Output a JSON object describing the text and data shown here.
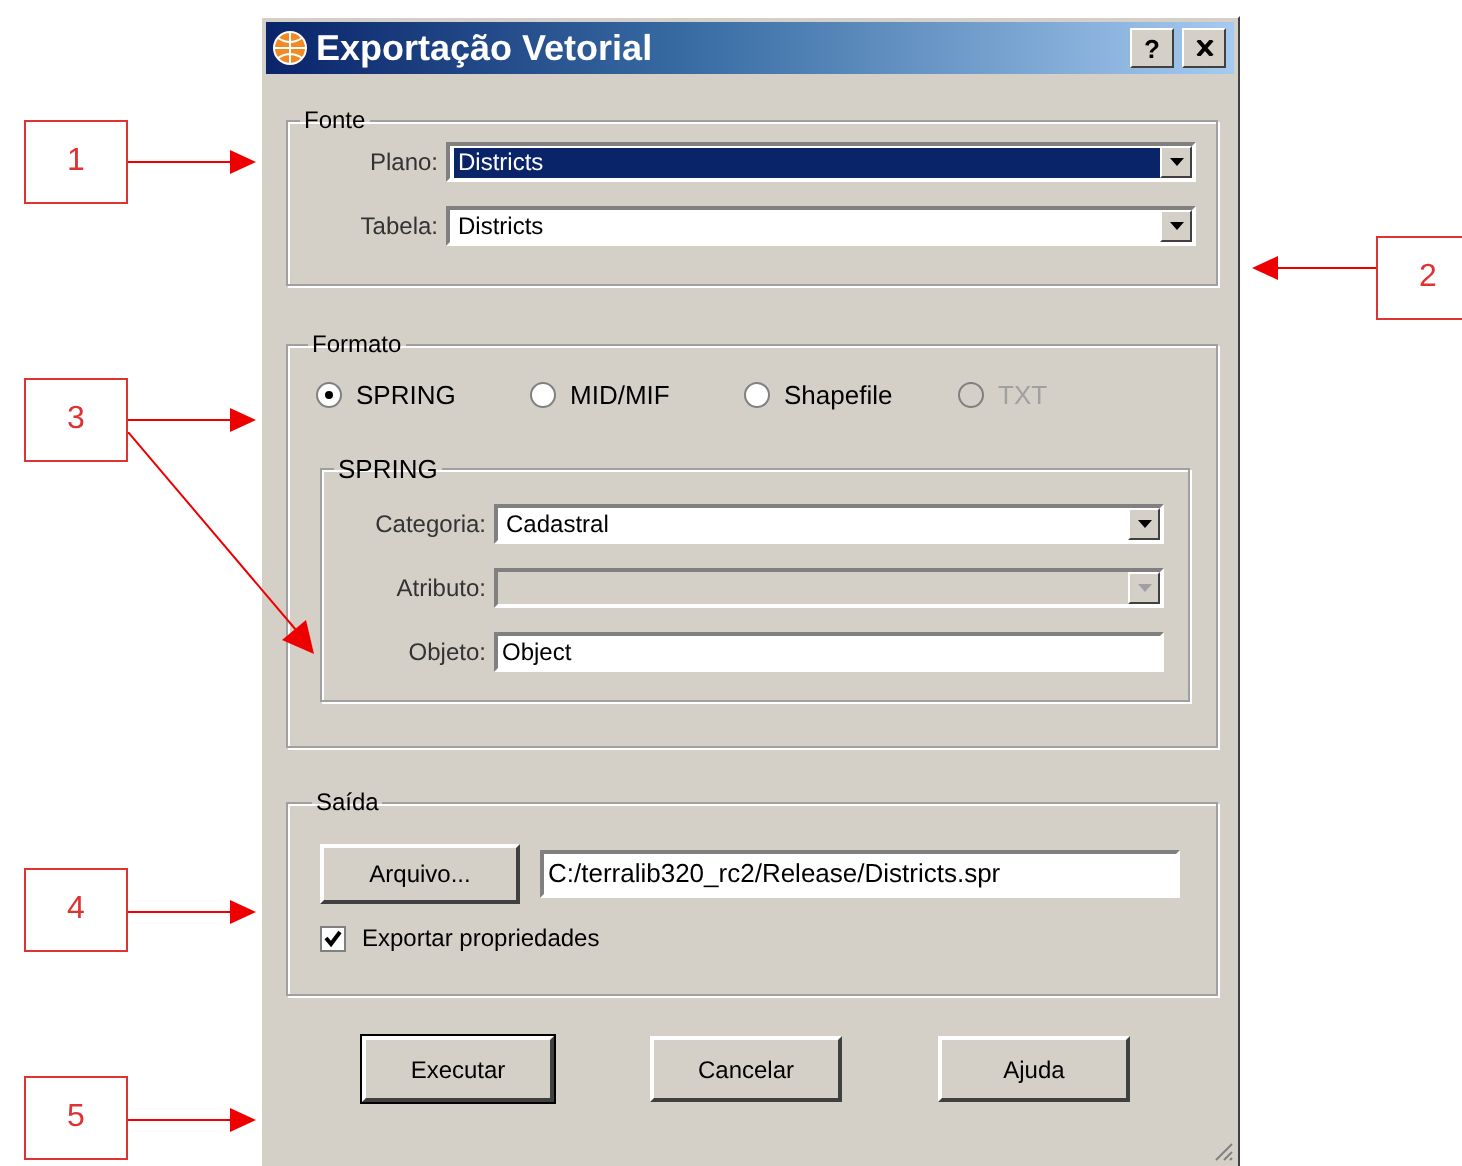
{
  "window": {
    "title": "Exportação Vetorial",
    "help": "?"
  },
  "fonte": {
    "title": "Fonte",
    "fields": [
      {
        "label": "Plano:",
        "value": "Districts",
        "selected": true,
        "disabled": false
      },
      {
        "label": "Tabela:",
        "value": "Districts",
        "selected": false,
        "disabled": false
      }
    ]
  },
  "formato": {
    "title": "Formato",
    "options": [
      {
        "label": "SPRING",
        "selected": true,
        "disabled": false
      },
      {
        "label": "MID/MIF",
        "selected": false,
        "disabled": false
      },
      {
        "label": "Shapefile",
        "selected": false,
        "disabled": false
      },
      {
        "label": "TXT",
        "selected": false,
        "disabled": true
      }
    ],
    "spring": {
      "title": "SPRING",
      "fields": [
        {
          "kind": "dropdown",
          "label": "Categoria:",
          "value": "Cadastral",
          "disabled": false
        },
        {
          "kind": "dropdown",
          "label": "Atributo:",
          "disabled": true
        },
        {
          "kind": "text",
          "label": "Objeto:",
          "value": "Object",
          "disabled": false
        }
      ]
    }
  },
  "saida": {
    "title": "Saída",
    "file_button": "Arquivo...",
    "path": "C:/terralib320_rc2/Release/Districts.spr",
    "checkbox": {
      "label": "Exportar propriedades",
      "checked": true
    }
  },
  "buttons": [
    "Executar",
    "Cancelar",
    "Ajuda"
  ],
  "callouts": [
    {
      "label": "1"
    },
    {
      "label": "2"
    },
    {
      "label": "3"
    },
    {
      "label": "4"
    },
    {
      "label": "5"
    }
  ]
}
